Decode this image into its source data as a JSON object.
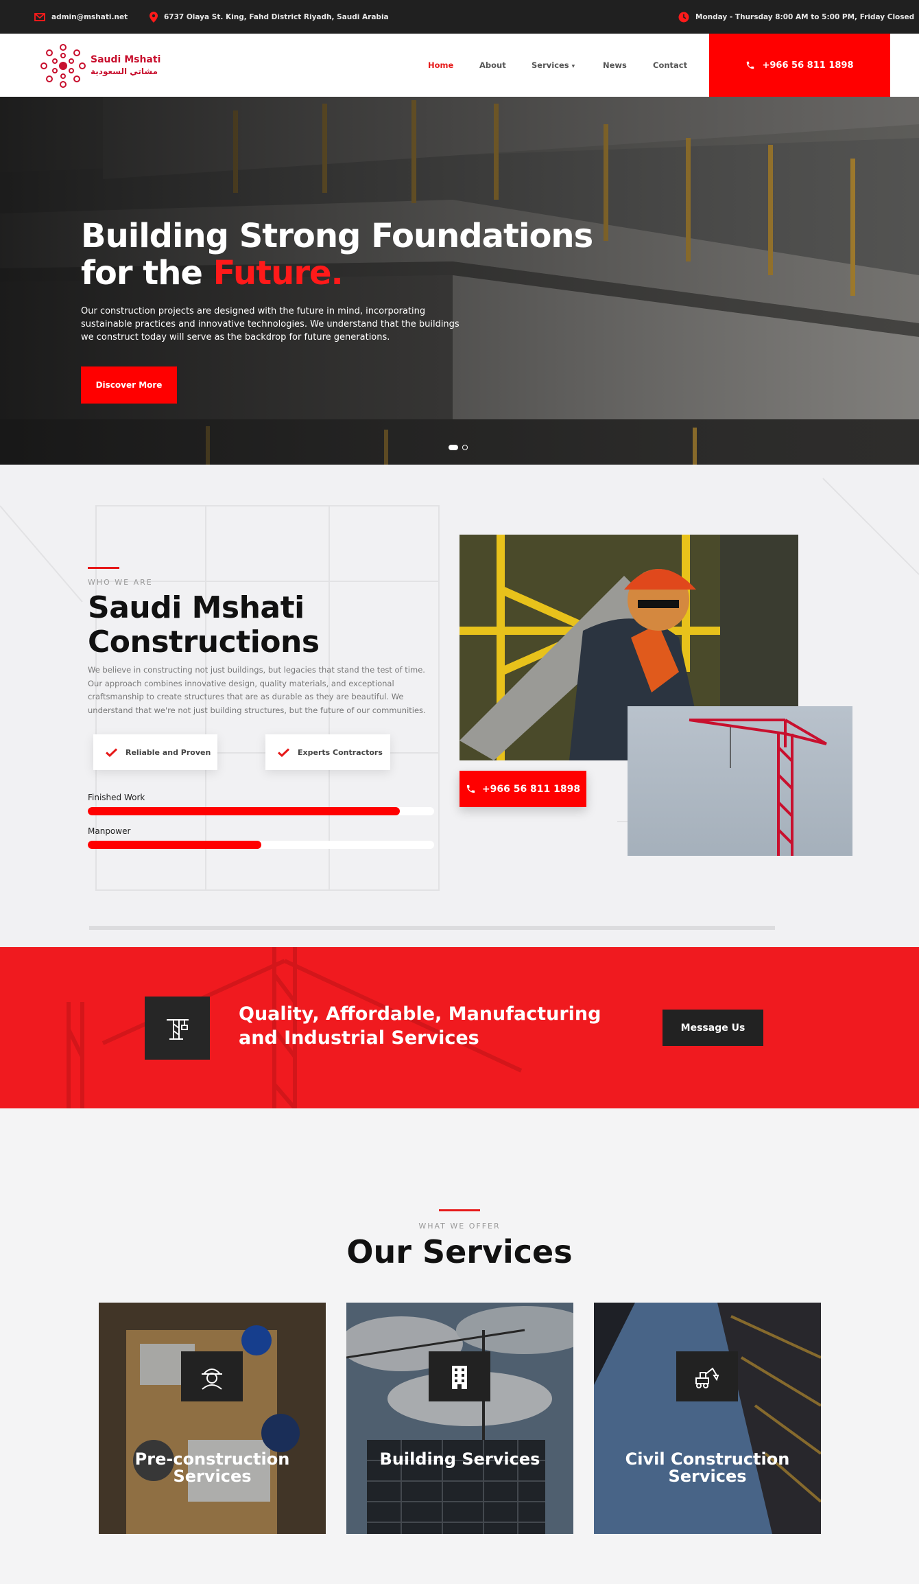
{
  "topbar": {
    "email": "admin@mshati.net",
    "address": "6737 Olaya St. King, Fahd District Riyadh, Saudi Arabia",
    "hours": "Monday - Thursday 8:00 AM to 5:00 PM, Friday Closed"
  },
  "header": {
    "brand": "Saudi Mshati",
    "brand_ar": "مشاتي السعودية",
    "nav": [
      "Home",
      "About",
      "Services",
      "News",
      "Contact"
    ],
    "phone": "+966 56 811 1898"
  },
  "hero": {
    "title_line1": "Building Strong Foundations",
    "title_line2_prefix": "for the ",
    "title_highlight": "Future.",
    "text": "Our construction projects are designed with the future in mind, incorporating sustainable practices and innovative technologies. We understand that the buildings we construct today will serve as the backdrop for future generations.",
    "button": "Discover More"
  },
  "about": {
    "kicker": "WHO WE ARE",
    "title_line1": "Saudi Mshati",
    "title_line2": "Constructions",
    "text": "We believe in constructing not just buildings, but legacies that stand the test of time. Our approach combines innovative design, quality materials, and exceptional craftsmanship to create structures that are as durable as they are beautiful. We understand that we're not just building structures, but the future of our communities.",
    "features": [
      "Reliable and Proven",
      "Experts Contractors"
    ],
    "bars": [
      {
        "label": "Finished Work",
        "value": 0.9
      },
      {
        "label": "Manpower",
        "value": 0.5
      }
    ],
    "phone": "+966 56 811 1898"
  },
  "banner": {
    "title_line1": "Quality, Affordable, Manufacturing",
    "title_line2": "and Industrial Services",
    "button": "Message Us"
  },
  "services": {
    "kicker": "WHAT WE OFFER",
    "title": "Our Services",
    "cards": [
      {
        "title_line1": "Pre-construction",
        "title_line2": "Services",
        "icon": "worker-helmet-icon"
      },
      {
        "title_line1": "Building Services",
        "title_line2": "",
        "icon": "building-icon"
      },
      {
        "title_line1": "Civil Construction",
        "title_line2": "Services",
        "icon": "excavator-icon"
      }
    ]
  },
  "colors": {
    "accent": "#ff0000",
    "dark": "#202020"
  }
}
